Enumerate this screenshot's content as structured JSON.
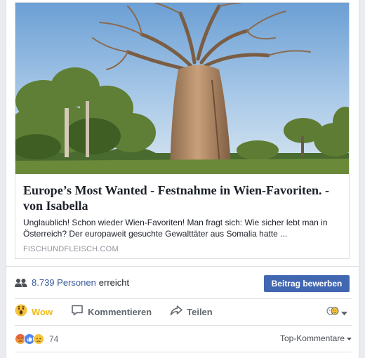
{
  "link_preview": {
    "title": "Europe’s Most Wanted - Festnahme in Wien-Favoriten. - von Isabella",
    "description": "Unglaublich! Schon wieder Wien-Favoriten! Man fragt sich: Wie sicher lebt man in Österreich? Der europaweit gesuchte Gewalttäter aus Somalia hatte ...",
    "domain": "FISCHUNDFLEISCH.COM"
  },
  "reach": {
    "count": "8.739 Personen",
    "suffix": "erreicht",
    "icon": "people-icon"
  },
  "boost_button": {
    "label": "Beitrag bewerben"
  },
  "actions": {
    "wow_label": "Wow",
    "comment_label": "Kommentieren",
    "share_label": "Teilen"
  },
  "reactions": {
    "count": "74",
    "types": [
      "angry",
      "like",
      "sad"
    ]
  },
  "sort": {
    "label": "Top-Kommentare"
  },
  "colors": {
    "link_blue": "#365899",
    "button_blue": "#4267b2",
    "wow_yellow": "#f0ba15",
    "muted": "#606770"
  }
}
